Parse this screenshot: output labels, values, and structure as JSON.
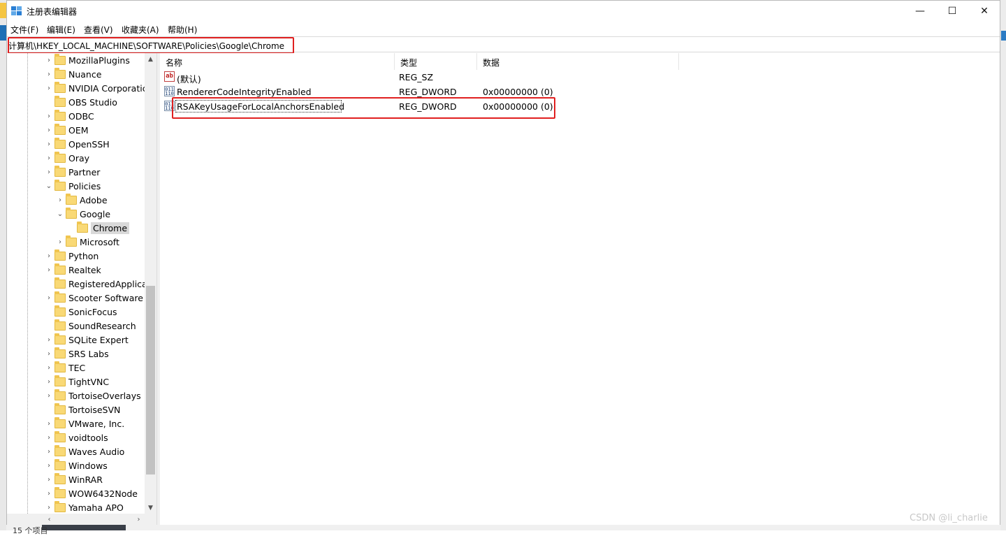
{
  "window": {
    "title": "注册表编辑器",
    "minimize_glyph": "—",
    "maximize_glyph": "☐",
    "close_glyph": "✕",
    "icon": "regedit-icon"
  },
  "menu": {
    "items": [
      "文件(F)",
      "编辑(E)",
      "查看(V)",
      "收藏夹(A)",
      "帮助(H)"
    ]
  },
  "address": {
    "path": "计算机\\HKEY_LOCAL_MACHINE\\SOFTWARE\\Policies\\Google\\Chrome"
  },
  "tree": {
    "items": [
      {
        "label": "MozillaPlugins",
        "chev": "›"
      },
      {
        "label": "Nuance",
        "chev": "›"
      },
      {
        "label": "NVIDIA Corporatic",
        "chev": "›"
      },
      {
        "label": "OBS Studio",
        "chev": ""
      },
      {
        "label": "ODBC",
        "chev": "›"
      },
      {
        "label": "OEM",
        "chev": "›"
      },
      {
        "label": "OpenSSH",
        "chev": "›"
      },
      {
        "label": "Oray",
        "chev": "›"
      },
      {
        "label": "Partner",
        "chev": "›"
      },
      {
        "label": "Policies",
        "chev": "⌄"
      },
      {
        "label": "Adobe",
        "chev": "›"
      },
      {
        "label": "Google",
        "chev": "⌄"
      },
      {
        "label": "Chrome",
        "chev": ""
      },
      {
        "label": "Microsoft",
        "chev": "›"
      },
      {
        "label": "Python",
        "chev": "›"
      },
      {
        "label": "Realtek",
        "chev": "›"
      },
      {
        "label": "RegisteredApplica",
        "chev": ""
      },
      {
        "label": "Scooter Software",
        "chev": "›"
      },
      {
        "label": "SonicFocus",
        "chev": ""
      },
      {
        "label": "SoundResearch",
        "chev": ""
      },
      {
        "label": "SQLite Expert",
        "chev": "›"
      },
      {
        "label": "SRS Labs",
        "chev": "›"
      },
      {
        "label": "TEC",
        "chev": "›"
      },
      {
        "label": "TightVNC",
        "chev": "›"
      },
      {
        "label": "TortoiseOverlays",
        "chev": "›"
      },
      {
        "label": "TortoiseSVN",
        "chev": ""
      },
      {
        "label": "VMware, Inc.",
        "chev": "›"
      },
      {
        "label": "voidtools",
        "chev": "›"
      },
      {
        "label": "Waves Audio",
        "chev": "›"
      },
      {
        "label": "Windows",
        "chev": "›"
      },
      {
        "label": "WinRAR",
        "chev": "›"
      },
      {
        "label": "WOW6432Node",
        "chev": "›"
      },
      {
        "label": "Yamaha APO",
        "chev": "›"
      }
    ],
    "selected": "Chrome"
  },
  "list": {
    "headers": {
      "name": "名称",
      "type": "类型",
      "data": "数据"
    },
    "rows": [
      {
        "name": "(默认)",
        "type": "REG_SZ",
        "data": "",
        "icon": "string-value-icon"
      },
      {
        "name": "RendererCodeIntegrityEnabled",
        "type": "REG_DWORD",
        "data": "0x00000000 (0)",
        "icon": "dword-value-icon"
      },
      {
        "name": "RSAKeyUsageForLocalAnchorsEnabled",
        "type": "REG_DWORD",
        "data": "0x00000000 (0)",
        "icon": "dword-value-icon"
      }
    ]
  },
  "overlay": {
    "watermark": "CSDN @li_charlie",
    "status": "15 个项目",
    "highlight_color": "#e02020"
  }
}
